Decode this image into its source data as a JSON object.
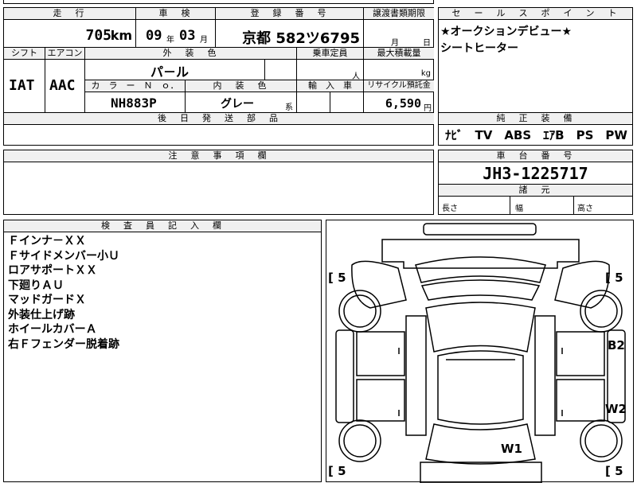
{
  "main": {
    "headers": {
      "mileage": "走　行",
      "inspection": "車　検",
      "registration": "登　録　番　号",
      "transfer_deadline": "譲渡書類期限",
      "shift": "シフト",
      "aircon": "エアコン",
      "exterior_color": "外　装　色",
      "capacity": "乗車定員",
      "max_load": "最大積載量",
      "color_no": "カ　ラ　ー　Ｎ　ｏ．",
      "interior_color": "内　装　色",
      "import": "輸　入　車",
      "recycle": "リサイクル預託金",
      "later_parts": "後　日　発　送　部　品"
    },
    "values": {
      "mileage": "705",
      "mileage_unit": "km",
      "insp_year": "09",
      "insp_year_unit": "年",
      "insp_month": "03",
      "insp_month_unit": "月",
      "registration": "京都 582ツ6795",
      "transfer_month_unit": "月",
      "transfer_day_unit": "日",
      "shift": "IAT",
      "aircon": "AAC",
      "exterior_color": "パ－ル",
      "capacity_unit": "人",
      "max_load_unit": "kg",
      "color_no": "NH883P",
      "interior_color": "グレー",
      "interior_suffix": "系",
      "recycle_amount": "6,590",
      "recycle_unit": "円"
    }
  },
  "sales_points": {
    "header": "セ　ー　ル　ス　ポ　イ　ン　ト",
    "lines": [
      "★オークションデビュー★",
      "シートヒーター"
    ]
  },
  "equipment": {
    "header": "純　正　装　備",
    "value": "ﾅﾋﾞ　TV　ABS　ｴｱB　PS　PW"
  },
  "notes": {
    "header": "注　意　事　項　欄"
  },
  "chassis": {
    "header": "車　台　番　号",
    "number": "JH3-1225717",
    "dims_header": "諸　元",
    "length": "長さ",
    "width": "幅",
    "height": "高さ"
  },
  "inspector": {
    "header": "検　査　員　記　入　欄",
    "lines": [
      "Ｆインナ－ＸＸ",
      "Ｆサイドメンバー小Ｕ",
      "ロアサポートＸＸ",
      "下廻りＡＵ",
      "マッドガードＸ",
      "外装仕上げ跡",
      "ホイールカバーＡ",
      "右Ｆフェンダー脱着跡"
    ]
  },
  "diagram": {
    "tires": [
      "[ 5",
      "[ 5",
      "[ 5",
      "[ 5"
    ],
    "marks": [
      "B2",
      "W2",
      "W1"
    ]
  }
}
